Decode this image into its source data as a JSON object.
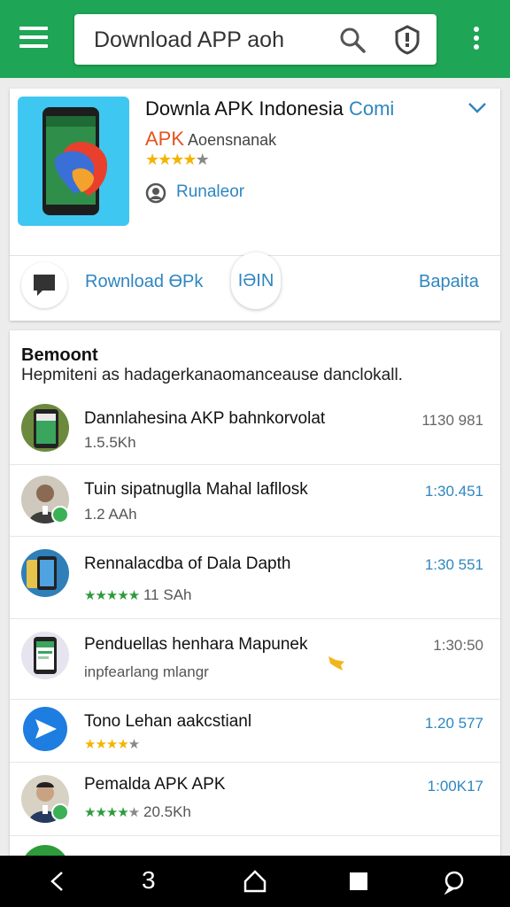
{
  "topbar": {
    "search_value": "Download APP aoh",
    "icons": [
      "menu-icon",
      "search-icon",
      "shield-icon",
      "more-vert-icon"
    ],
    "accent": "#1ea555"
  },
  "app": {
    "title": "Downla APK Indonesia",
    "title_suffix": "Comi",
    "apk_label": "APK",
    "developer": "Aoensnanak",
    "rating_stars": "★★★★★",
    "author": "Runaleor",
    "download_label": "Rownload ӨPk",
    "pill_label": "IƏIN",
    "right_link": "Bapaita"
  },
  "recommended": {
    "title": "Bemoont",
    "subtitle": "Hepmiteni as hadagerkanaomanceause danclokall.",
    "items": [
      {
        "title": "Dannlahesina AKP bahnkorvolat",
        "sub": "1.5.5Kh",
        "meta": "1130 981"
      },
      {
        "title": "Tuin sipatnuglla Mahal lafllosk",
        "sub": "1.2 AAh",
        "meta": "1:30.451"
      },
      {
        "title": "Rennalacdba of Dala Dapth",
        "stars": "★★★★★",
        "sub": "11 SAh",
        "meta": "1:30 551"
      },
      {
        "title": "Penduellas henhara Mapunek",
        "sub": "inpfearlang mlangr",
        "meta": "1:30:50"
      },
      {
        "title": "Tono Lehan aakcstianl",
        "stars": "★★★★",
        "sub": "",
        "meta": "1.20 577"
      },
      {
        "title": "Pemalda APK APK",
        "stars": "★★★★",
        "sub": "20.5Kh",
        "meta": "1:00K17"
      }
    ]
  },
  "navbar": {
    "icons": [
      "back-icon",
      "three-icon",
      "home-icon",
      "recents-icon",
      "assistant-icon"
    ],
    "three_label": "3"
  }
}
